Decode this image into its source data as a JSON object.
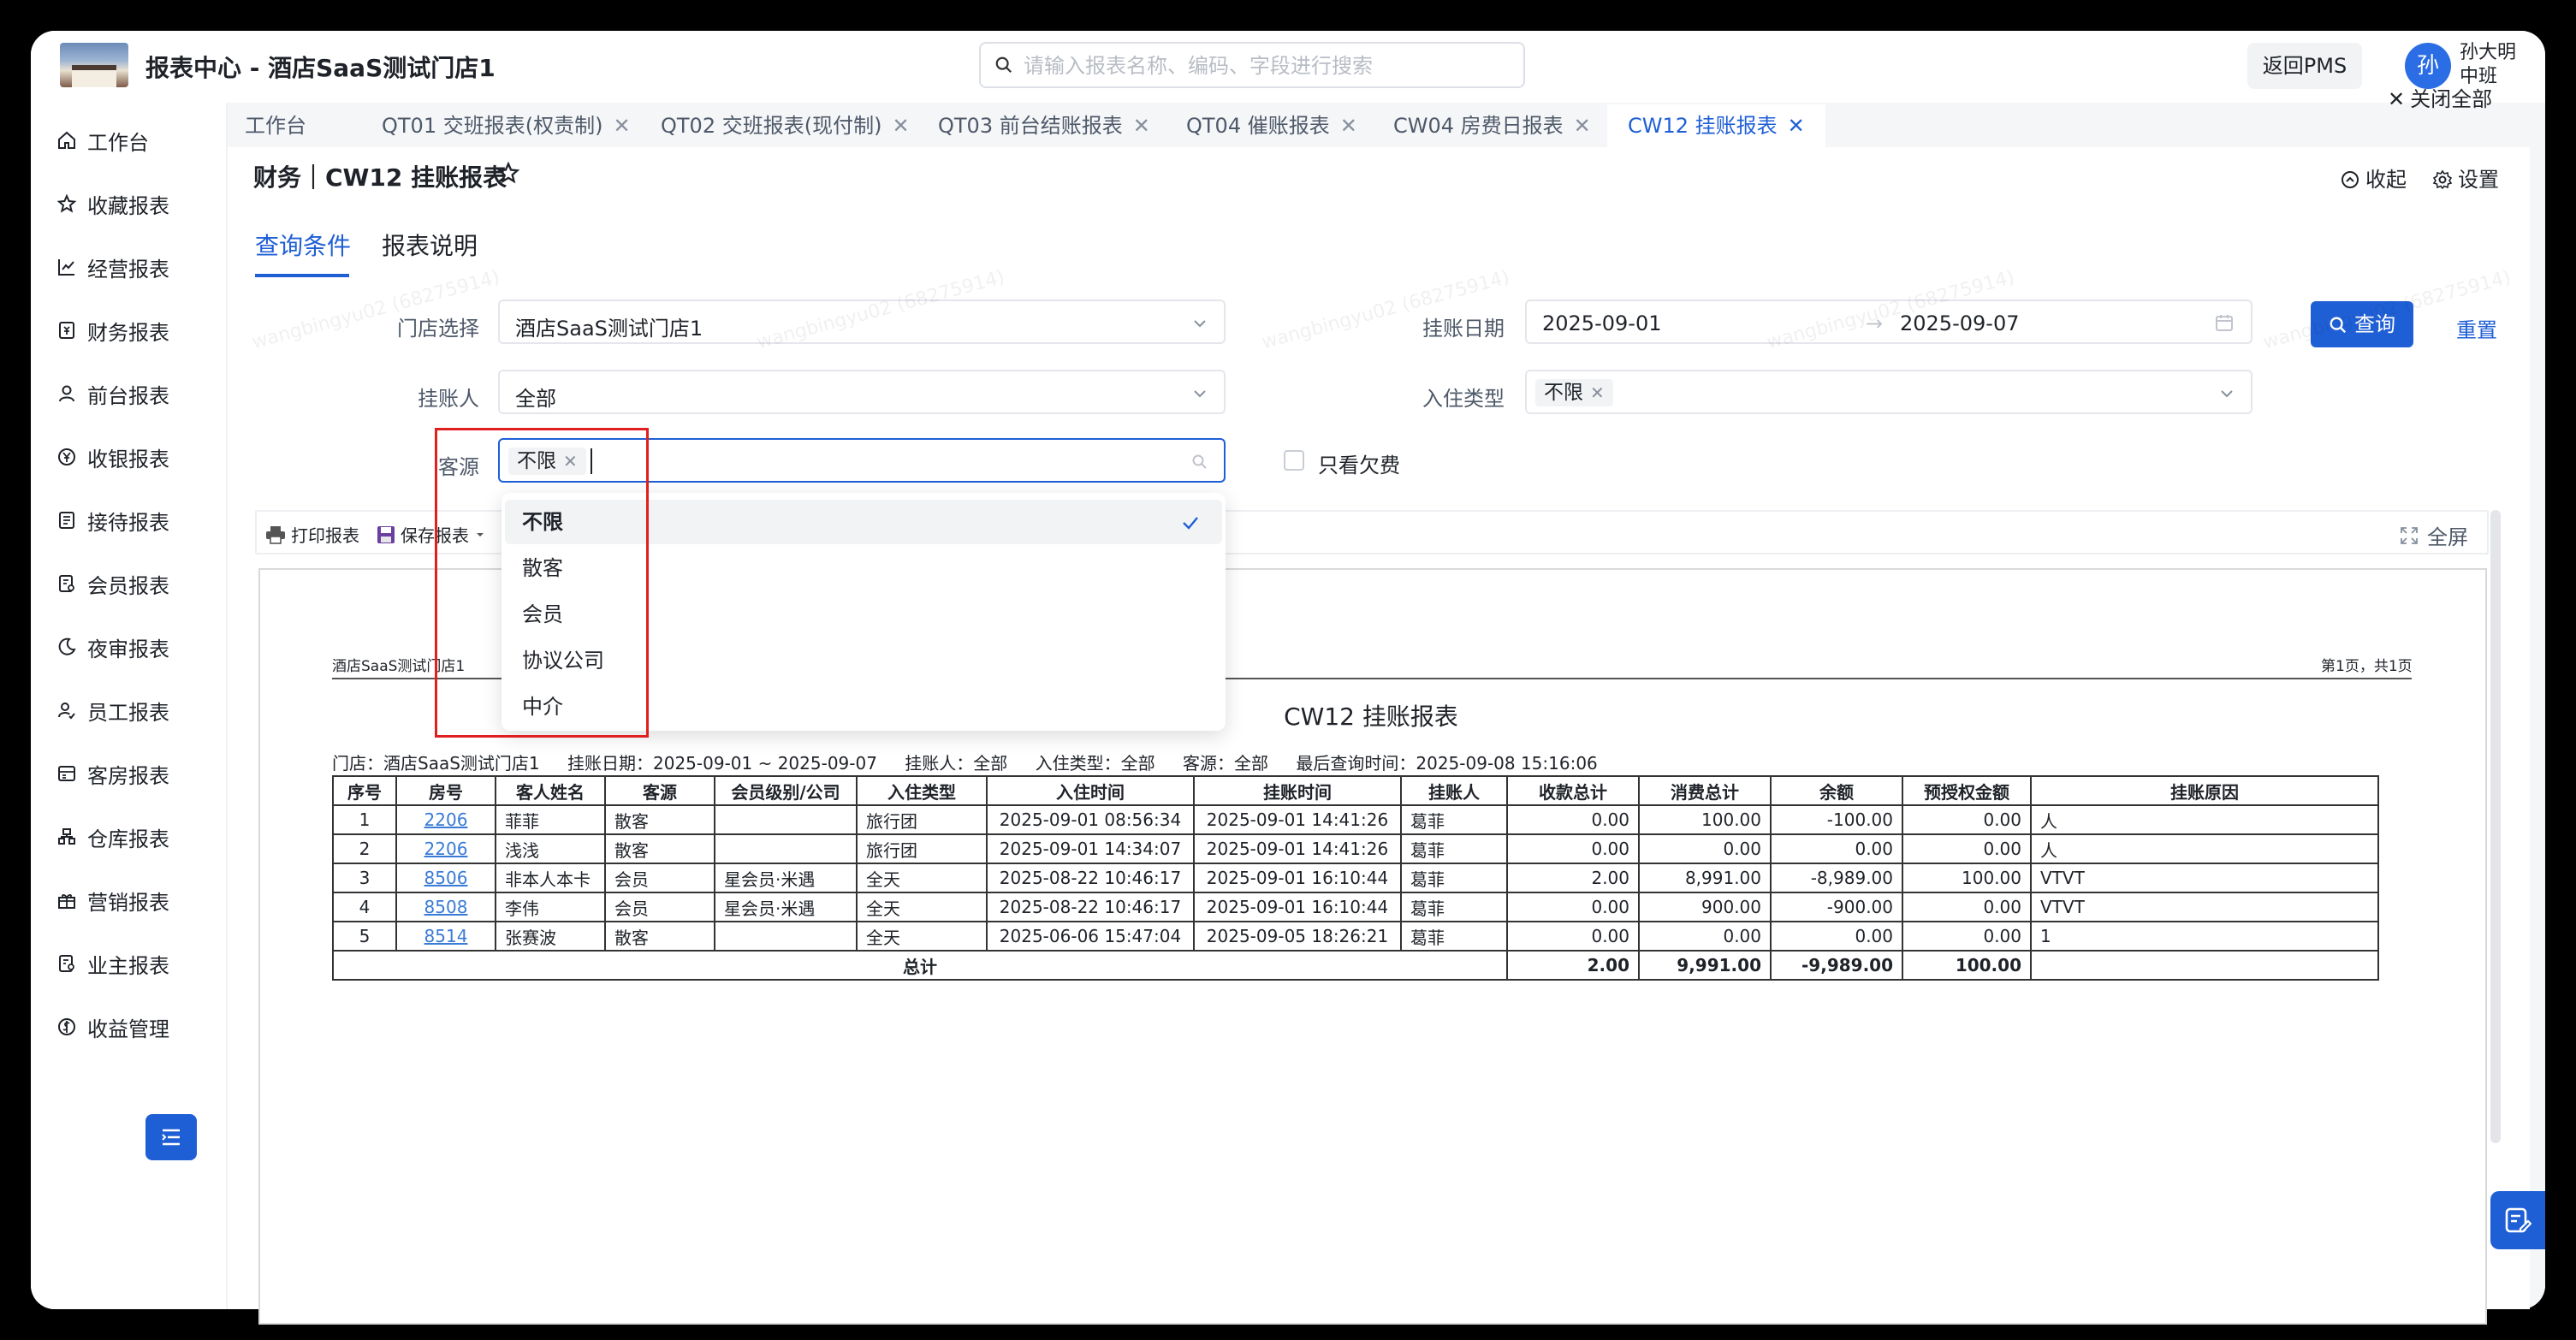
{
  "header": {
    "title": "报表中心 - 酒店SaaS测试门店1",
    "search_placeholder": "请输入报表名称、编码、字段进行搜索",
    "pms_button": "返回PMS",
    "avatar_char": "孙",
    "user_name": "孙大明",
    "user_shift": "中班"
  },
  "sidebar": {
    "items": [
      {
        "label": "工作台",
        "icon": "home-icon"
      },
      {
        "label": "收藏报表",
        "icon": "star-icon"
      },
      {
        "label": "经营报表",
        "icon": "chart-icon"
      },
      {
        "label": "财务报表",
        "icon": "finance-icon"
      },
      {
        "label": "前台报表",
        "icon": "user-icon"
      },
      {
        "label": "收银报表",
        "icon": "yen-icon"
      },
      {
        "label": "接待报表",
        "icon": "doc-icon"
      },
      {
        "label": "会员报表",
        "icon": "member-icon"
      },
      {
        "label": "夜审报表",
        "icon": "moon-icon"
      },
      {
        "label": "员工报表",
        "icon": "staff-icon"
      },
      {
        "label": "客房报表",
        "icon": "room-icon"
      },
      {
        "label": "仓库报表",
        "icon": "warehouse-icon"
      },
      {
        "label": "营销报表",
        "icon": "gift-icon"
      },
      {
        "label": "业主报表",
        "icon": "owner-icon"
      },
      {
        "label": "收益管理",
        "icon": "revenue-icon"
      }
    ]
  },
  "tabs": [
    {
      "label": "工作台"
    },
    {
      "label": "QT01 交班报表(权责制)"
    },
    {
      "label": "QT02 交班报表(现付制)"
    },
    {
      "label": "QT03 前台结账报表"
    },
    {
      "label": "QT04 催账报表"
    },
    {
      "label": "CW04 房费日报表"
    },
    {
      "label": "CW12 挂账报表"
    }
  ],
  "tab_close_glyph": "✕",
  "close_all": "关闭全部",
  "page": {
    "title": "财务｜CW12 挂账报表",
    "collapse": "收起",
    "settings": "设置",
    "sub_tabs": [
      "查询条件",
      "报表说明"
    ]
  },
  "form": {
    "store_label": "门店选择",
    "store_value": "酒店SaaS测试门店1",
    "date_label": "挂账日期",
    "date_start": "2025-09-01",
    "date_sep": "→",
    "date_end": "2025-09-07",
    "person_label": "挂账人",
    "person_value": "全部",
    "checkin_label": "入住类型",
    "checkin_tag": "不限",
    "source_label": "客源",
    "source_tag": "不限",
    "query_button": "查询",
    "reset_button": "重置",
    "arrears_label": "只看欠费"
  },
  "toolbar": {
    "print": "打印报表",
    "save": "保存报表",
    "fullscreen": "全屏"
  },
  "dropdown": {
    "options": [
      "不限",
      "散客",
      "会员",
      "协议公司",
      "中介"
    ],
    "selected_index": 0
  },
  "report": {
    "store_name": "酒店SaaS测试门店1",
    "page_info": "第1页，共1页",
    "title": "CW12 挂账报表",
    "meta": [
      "门店：酒店SaaS测试门店1",
      "挂账日期：2025-09-01 ~ 2025-09-07",
      "挂账人：全部",
      "入住类型：全部",
      "客源：全部",
      "最后查询时间：2025-09-08 15:16:06"
    ],
    "columns": [
      "序号",
      "房号",
      "客人姓名",
      "客源",
      "会员级别/公司",
      "入住类型",
      "入住时间",
      "挂账时间",
      "挂账人",
      "收款总计",
      "消费总计",
      "余额",
      "预授权金额",
      "挂账原因"
    ],
    "rows": [
      [
        "1",
        "2206",
        "菲菲",
        "散客",
        "",
        "旅行团",
        "2025-09-01 08:56:34",
        "2025-09-01 14:41:26",
        "葛菲",
        "0.00",
        "100.00",
        "-100.00",
        "0.00",
        "人"
      ],
      [
        "2",
        "2206",
        "浅浅",
        "散客",
        "",
        "旅行团",
        "2025-09-01 14:34:07",
        "2025-09-01 14:41:26",
        "葛菲",
        "0.00",
        "0.00",
        "0.00",
        "0.00",
        "人"
      ],
      [
        "3",
        "8506",
        "非本人本卡",
        "会员",
        "星会员·米遇",
        "全天",
        "2025-08-22 10:46:17",
        "2025-09-01 16:10:44",
        "葛菲",
        "2.00",
        "8,991.00",
        "-8,989.00",
        "100.00",
        "VTVT"
      ],
      [
        "4",
        "8508",
        "李伟",
        "会员",
        "星会员·米遇",
        "全天",
        "2025-08-22 10:46:17",
        "2025-09-01 16:10:44",
        "葛菲",
        "0.00",
        "900.00",
        "-900.00",
        "0.00",
        "VTVT"
      ],
      [
        "5",
        "8514",
        "张赛波",
        "散客",
        "",
        "全天",
        "2025-06-06 15:47:04",
        "2025-09-05 18:26:21",
        "葛菲",
        "0.00",
        "0.00",
        "0.00",
        "0.00",
        "1"
      ]
    ],
    "total": {
      "label": "总计",
      "receipts": "2.00",
      "consumption": "9,991.00",
      "balance": "-9,989.00",
      "preauth": "100.00"
    }
  },
  "watermark": "wangbingyu02 (68275914)"
}
